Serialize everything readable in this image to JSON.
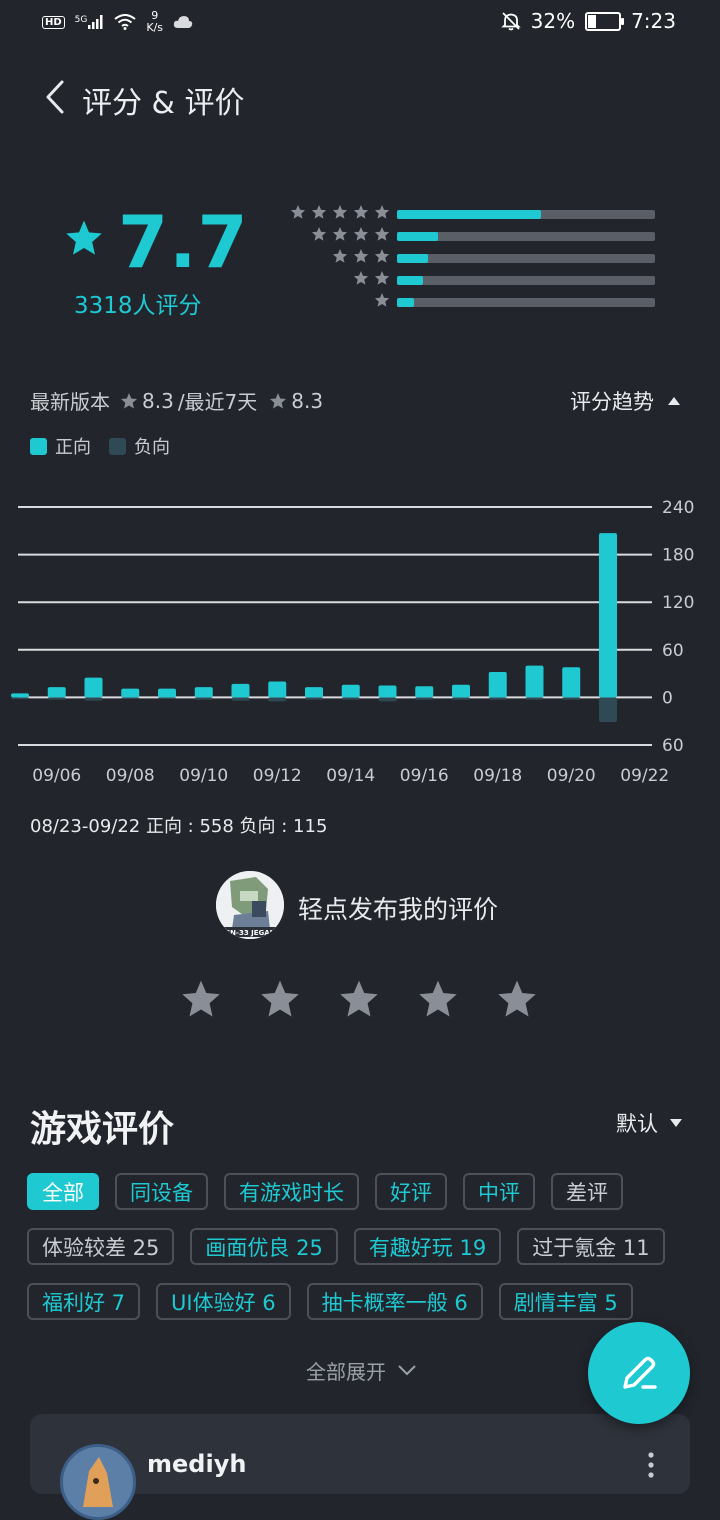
{
  "status_bar": {
    "hd": "HD",
    "network": "5G",
    "speed_value": "9",
    "speed_unit": "K/s",
    "battery": "32%",
    "battery_level": 0.32,
    "time": "7:23"
  },
  "header": {
    "title": "评分 & 评价"
  },
  "rating": {
    "score": "7.7",
    "count_label": "3318人评分",
    "distribution": [
      {
        "stars": 5,
        "fraction": 0.56
      },
      {
        "stars": 4,
        "fraction": 0.16
      },
      {
        "stars": 3,
        "fraction": 0.12
      },
      {
        "stars": 2,
        "fraction": 0.1
      },
      {
        "stars": 1,
        "fraction": 0.065
      }
    ]
  },
  "trend": {
    "latest_label": "最新版本",
    "latest_score": "8.3",
    "sep_label": "/最近7天",
    "recent_score": "8.3",
    "toggle_label": "评分趋势",
    "legend_pos": "正向",
    "legend_neg": "负向",
    "summary": "08/23-09/22  正向 : 558   负向 : 115"
  },
  "chart_data": {
    "type": "bar",
    "x": [
      "09/05",
      "09/06",
      "09/07",
      "09/08",
      "09/09",
      "09/10",
      "09/11",
      "09/12",
      "09/13",
      "09/14",
      "09/15",
      "09/16",
      "09/17",
      "09/18",
      "09/19",
      "09/20",
      "09/21",
      "09/22"
    ],
    "series": [
      {
        "name": "正向",
        "values": [
          5,
          13,
          25,
          11,
          11,
          13,
          17,
          20,
          13,
          16,
          15,
          14,
          16,
          32,
          40,
          38,
          207,
          0
        ]
      },
      {
        "name": "负向",
        "values": [
          -2,
          -3,
          -4,
          -2,
          -2,
          -3,
          -4,
          -5,
          -3,
          -3,
          -5,
          -3,
          -3,
          -3,
          -3,
          -3,
          -31,
          0
        ]
      }
    ],
    "x_tick_labels": [
      "09/06",
      "09/08",
      "09/10",
      "09/12",
      "09/14",
      "09/16",
      "09/18",
      "09/20",
      "09/22"
    ],
    "y_tick_labels": [
      "240",
      "180",
      "120",
      "60",
      "0",
      "60"
    ],
    "ylim": [
      -60,
      240
    ],
    "colors": {
      "positive": "#1ec9d2",
      "negative": "#2f4a55"
    }
  },
  "my_review": {
    "prompt": "轻点发布我的评价",
    "avatar_text": "GN-33 JEGAN"
  },
  "reviews": {
    "section_title": "游戏评价",
    "sort_label": "默认",
    "tag_rows": [
      [
        {
          "label": "全部",
          "style": "active"
        },
        {
          "label": "同设备",
          "style": "accent"
        },
        {
          "label": "有游戏时长",
          "style": "accent"
        },
        {
          "label": "好评",
          "style": "accent"
        },
        {
          "label": "中评",
          "style": "accent"
        },
        {
          "label": "差评",
          "style": "gray"
        }
      ],
      [
        {
          "label": "体验较差 25",
          "style": "gray"
        },
        {
          "label": "画面优良 25",
          "style": "accent"
        },
        {
          "label": "有趣好玩 19",
          "style": "accent"
        },
        {
          "label": "过于氪金 11",
          "style": "gray"
        }
      ],
      [
        {
          "label": "福利好 7",
          "style": "accent"
        },
        {
          "label": "UI体验好  6",
          "style": "accent"
        },
        {
          "label": "抽卡概率一般 6",
          "style": "accent"
        },
        {
          "label": "剧情丰富 5",
          "style": "accent"
        }
      ]
    ],
    "expand_label": "全部展开",
    "first_review_user": "mediyh"
  },
  "icons": {
    "back": "chevron-left-icon",
    "star": "star-icon",
    "caret_up": "caret-up-icon",
    "caret_down": "caret-down-icon",
    "chevron_down": "chevron-down-icon",
    "pen": "pen-icon",
    "more": "more-vertical-icon"
  },
  "colors": {
    "accent": "#1ec9d2",
    "background": "#22252c",
    "muted_star": "#8a8f97"
  }
}
